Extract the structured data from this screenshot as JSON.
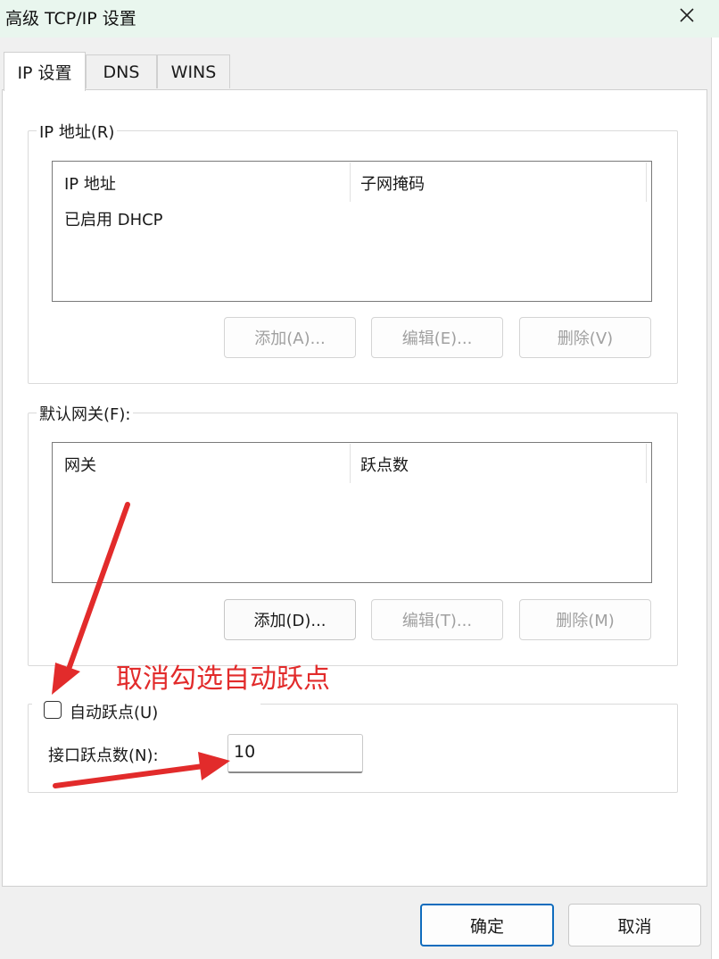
{
  "window": {
    "title": "高级 TCP/IP 设置",
    "close_icon": "close-icon"
  },
  "tabs": [
    {
      "label": "IP 设置",
      "active": true
    },
    {
      "label": "DNS",
      "active": false
    },
    {
      "label": "WINS",
      "active": false
    }
  ],
  "ip_group": {
    "label": "IP 地址(R)",
    "columns": [
      "IP 地址",
      "子网掩码"
    ],
    "rows": [
      [
        "已启用 DHCP",
        ""
      ]
    ],
    "buttons": {
      "add": "添加(A)...",
      "edit": "编辑(E)...",
      "remove": "删除(V)"
    }
  },
  "gateway_group": {
    "label": "默认网关(F):",
    "columns": [
      "网关",
      "跃点数"
    ],
    "rows": [],
    "buttons": {
      "add": "添加(D)...",
      "edit": "编辑(T)...",
      "remove": "删除(M)"
    }
  },
  "metric_group": {
    "auto_metric_label": "自动跃点(U)",
    "auto_metric_checked": false,
    "interface_metric_label": "接口跃点数(N):",
    "interface_metric_value": "10"
  },
  "annotation": {
    "text": "取消勾选自动跃点",
    "color": "#e22b2b"
  },
  "dialog_buttons": {
    "ok": "确定",
    "cancel": "取消"
  }
}
